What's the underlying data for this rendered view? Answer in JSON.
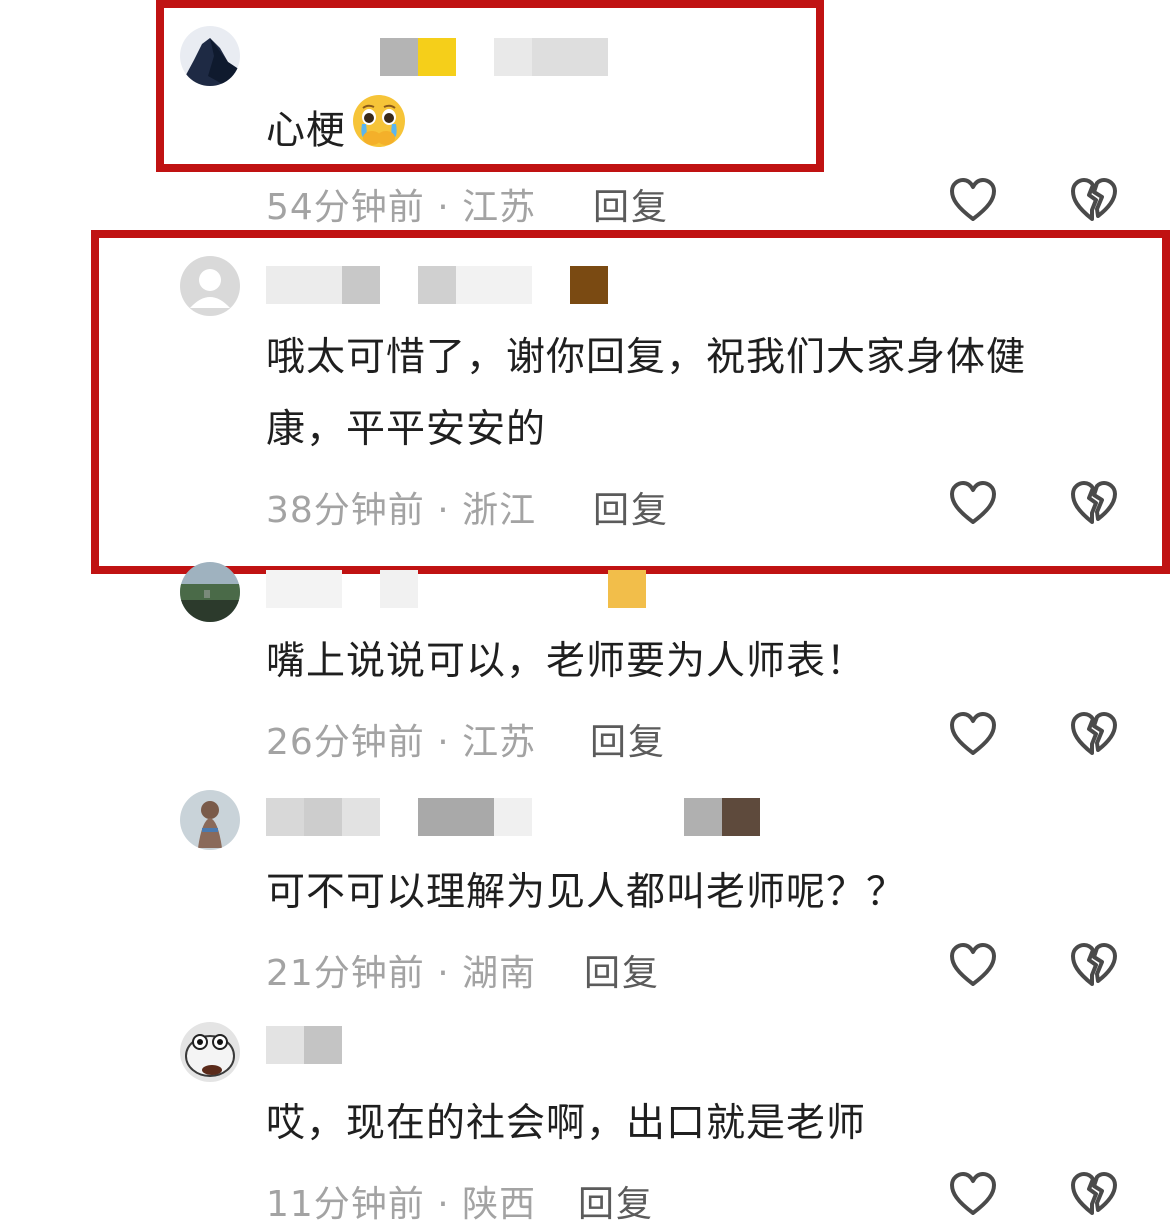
{
  "comments": [
    {
      "text": "心梗",
      "emoji": "pleading-crying-face-emoji",
      "time": "54分钟前",
      "separator": "·",
      "location": "江苏",
      "reply": "回复"
    },
    {
      "text": "哦太可惜了，谢你回复，祝我们大家身体健康，平平安安的",
      "line1": "哦太可惜了，谢你回复，祝我们大家身体健",
      "line2": "康，平平安安的",
      "time": "38分钟前",
      "separator": "·",
      "location": "浙江",
      "reply": "回复"
    },
    {
      "text": "嘴上说说可以，老师要为人师表！",
      "time": "26分钟前",
      "separator": "·",
      "location": "江苏",
      "reply": "回复"
    },
    {
      "text": "可不可以理解为见人都叫老师呢？？",
      "time": "21分钟前",
      "separator": "·",
      "location": "湖南",
      "reply": "回复"
    },
    {
      "text": "哎，现在的社会啊，出口就是老师",
      "time": "11分钟前",
      "separator": "·",
      "location": "陕西",
      "reply": "回复"
    }
  ],
  "icons": {
    "like": "heart-outline-icon",
    "dislike": "broken-heart-icon"
  },
  "colors": {
    "highlight": "#c01212",
    "meta_text": "#a3a3a3",
    "reply_text": "#5b5b5b",
    "icon_stroke": "#4a4a4a"
  }
}
